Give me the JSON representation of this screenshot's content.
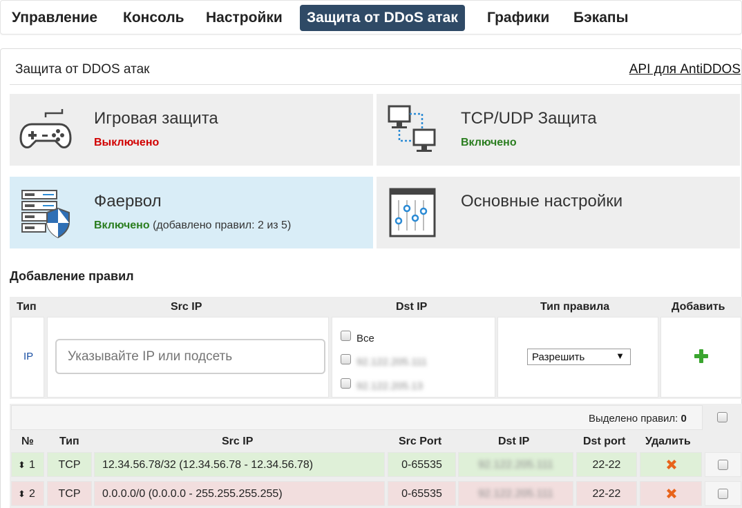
{
  "nav": {
    "tabs": [
      {
        "label": "Управление"
      },
      {
        "label": "Консоль"
      },
      {
        "label": "Настройки"
      },
      {
        "label": "Защита от DDoS атак",
        "active": true
      },
      {
        "label": "Графики"
      },
      {
        "label": "Бэкапы"
      }
    ]
  },
  "page": {
    "title": "Защита от DDOS атак",
    "api_link": "API для AntiDDOS"
  },
  "tiles": [
    {
      "title": "Игровая защита",
      "status": "Выключено",
      "icon": "gamepad-icon"
    },
    {
      "title": "TCP/UDP Защита",
      "status": "Включено",
      "icon": "network-icon"
    },
    {
      "title": "Фаервол",
      "status": "Включено",
      "extra": "(добавлено правил: 2 из 5)",
      "icon": "firewall-shield-icon"
    },
    {
      "title": "Основные настройки",
      "icon": "settings-sliders-icon"
    }
  ],
  "add_rules": {
    "title": "Добавление правил",
    "headers": {
      "type": "Тип",
      "src_ip": "Src IP",
      "dst_ip": "Dst IP",
      "rule_type": "Тип правила",
      "add": "Добавить"
    },
    "type_value": "IP",
    "src_placeholder": "Указывайте IP или подсеть",
    "dst_options": [
      "Все",
      "92.122.205.111",
      "92.122.205.13"
    ],
    "rule_type_selected": "Разрешить"
  },
  "rules_table": {
    "selected_label": "Выделено правил:",
    "selected_count": "0",
    "headers": [
      "№",
      "Тип",
      "Src IP",
      "Src Port",
      "Dst IP",
      "Dst port",
      "Удалить"
    ],
    "rows": [
      {
        "num": "1",
        "type": "TCP",
        "src_ip": "12.34.56.78/32 (12.34.56.78 - 12.34.56.78)",
        "src_port": "0-65535",
        "dst_ip": "92.122.205.111",
        "dst_port": "22-22",
        "status": "allow"
      },
      {
        "num": "2",
        "type": "TCP",
        "src_ip": "0.0.0.0/0 (0.0.0.0 - 255.255.255.255)",
        "src_port": "0-65535",
        "dst_ip": "92.122.205.111",
        "dst_port": "22-22",
        "status": "deny"
      }
    ]
  },
  "colors": {
    "nav_active": "#2f4a66",
    "status_on": "#2a7d1f",
    "status_off": "#d10000",
    "row_allow": "#dff0d8",
    "row_deny": "#f2dede",
    "tile_highlight": "#d9edf7",
    "plus": "#3aa52f",
    "delete": "#e8641b"
  }
}
